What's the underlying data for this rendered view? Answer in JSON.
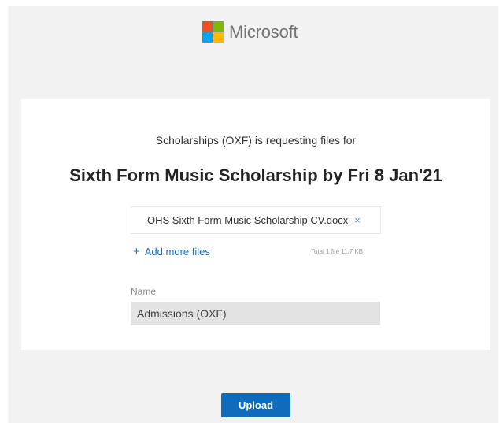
{
  "brand": {
    "name": "Microsoft",
    "logo_colors": [
      "#f25022",
      "#7fba00",
      "#00a4ef",
      "#ffb900"
    ]
  },
  "request": {
    "requester_line": "Scholarships (OXF) is requesting files for",
    "title": "Sixth Form Music Scholarship by Fri 8 Jan'21"
  },
  "files": {
    "items": [
      {
        "name": "OHS Sixth Form Music Scholarship CV.docx",
        "remove_icon": "×"
      }
    ],
    "add_more_icon": "+",
    "add_more_label": "Add more files",
    "summary": "Total 1 file  11.7 KB"
  },
  "form": {
    "name_label": "Name",
    "name_value": "Admissions (OXF)"
  },
  "actions": {
    "upload_label": "Upload"
  },
  "colors": {
    "accent": "#0f6cbd",
    "link": "#1a6fc9",
    "page_background": "#f2f2f2"
  }
}
